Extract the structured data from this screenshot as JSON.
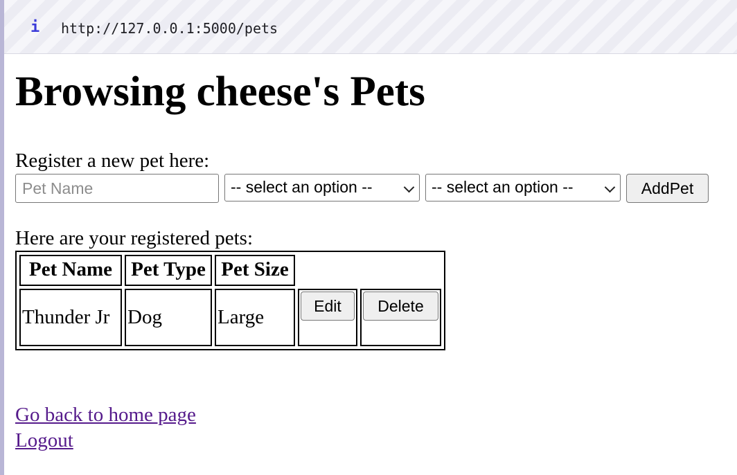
{
  "browser": {
    "info_glyph": "i",
    "url": "http://127.0.0.1:5000/pets"
  },
  "page": {
    "title": "Browsing cheese's Pets",
    "register_label": "Register a new pet here:",
    "form": {
      "pet_name_placeholder": "Pet Name",
      "pet_name_value": "",
      "pet_type_selected": "-- select an option --",
      "pet_size_selected": "-- select an option --",
      "add_button": "AddPet"
    },
    "list_label": "Here are your registered pets:",
    "table": {
      "headers": [
        "Pet Name",
        "Pet Type",
        "Pet Size"
      ],
      "rows": [
        {
          "name": "Thunder Jr",
          "type": "Dog",
          "size": "Large",
          "edit_label": "Edit",
          "delete_label": "Delete"
        }
      ]
    },
    "links": {
      "home": "Go back to home page",
      "logout": "Logout"
    }
  },
  "colors": {
    "link_visited": "#551a8b",
    "info_icon": "#3b3bd9"
  }
}
